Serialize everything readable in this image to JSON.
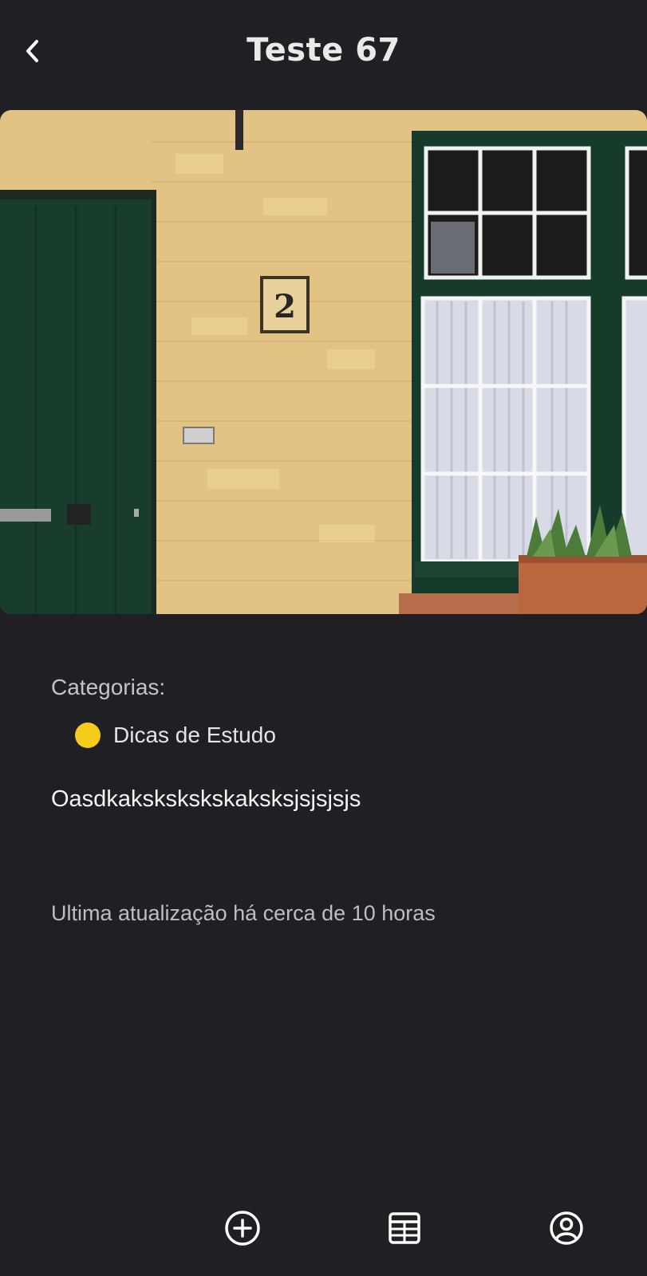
{
  "header": {
    "title": "Teste 67",
    "back_icon": "chevron-left-icon"
  },
  "hero": {
    "house_number": "2"
  },
  "details": {
    "categories_label": "Categorias:",
    "categories": [
      {
        "name": "Dicas de Estudo",
        "color": "#f5cc1b"
      }
    ],
    "body": "Oasdkakskskskskaksksjsjsjsjs",
    "last_update": "Ultima atualização há cerca de 10 horas"
  },
  "bottom_nav": {
    "items": [
      {
        "icon": "plus-circle-icon"
      },
      {
        "icon": "table-icon"
      },
      {
        "icon": "user-circle-icon"
      }
    ]
  },
  "colors": {
    "background": "#202024",
    "text_primary": "#f4f4f5",
    "text_secondary": "#c4c4c8"
  }
}
